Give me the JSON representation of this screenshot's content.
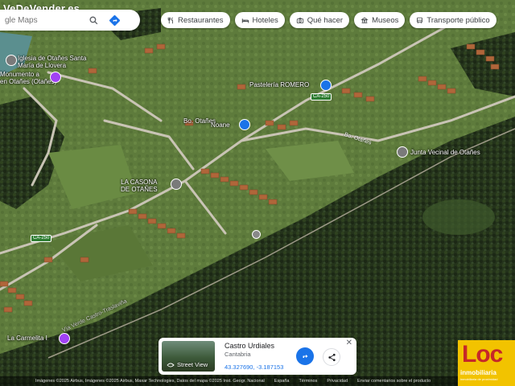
{
  "watermark": "VeDeVender.es",
  "search": {
    "placeholder": "gle Maps"
  },
  "chips": [
    {
      "label": "Restaurantes",
      "icon": "fork-knife-icon"
    },
    {
      "label": "Hoteles",
      "icon": "bed-icon"
    },
    {
      "label": "Qué hacer",
      "icon": "camera-icon"
    },
    {
      "label": "Museos",
      "icon": "museum-icon"
    },
    {
      "label": "Transporte público",
      "icon": "bus-icon"
    }
  ],
  "places": {
    "iglesia": "Iglesia de Otañes Santa\nMaría de Llovera",
    "monumento": "Monumento a\nen Otañes (Otañes)",
    "pasteleria": "Pastelería ROMERO",
    "bo_otanes_1": "Bo. Otañes",
    "noane": "Noane",
    "bo_otanes_2": "Bo. Otañes",
    "junta": "Junta Vecinal de Otañes",
    "casona": "LA CASONA\nDE OTAÑES",
    "carmelita": "La Carmelita I",
    "road_viaverde": "Vía Verde Castro-Traslaviña",
    "shield_ca250_a": "CA-250",
    "shield_ca250_b": "CA-250"
  },
  "card": {
    "title": "Castro Urdiales",
    "subtitle": "Cantabria",
    "coords": "43.327690, -3.187153",
    "street_view_label": "Street View",
    "close": "✕"
  },
  "attribution": {
    "imagery": "Imágenes ©2025 Airbus, Imágenes ©2025 Airbus, Maxar Technologies, Datos del mapa ©2025 Inst. Geogr. Nacional",
    "country": "España",
    "terms": "Términos",
    "privacy": "Privacidad",
    "feedback": "Enviar comentarios sobre el producto"
  },
  "logo": {
    "text": "Loc",
    "subtitle": "inmobiliaria",
    "tagline": "inmobiliaria de proximidad"
  },
  "colors": {
    "pin_purple": "#a142f4",
    "pin_blue": "#1a73e8",
    "forest": "#24331b",
    "field": "#5d7a3a"
  }
}
